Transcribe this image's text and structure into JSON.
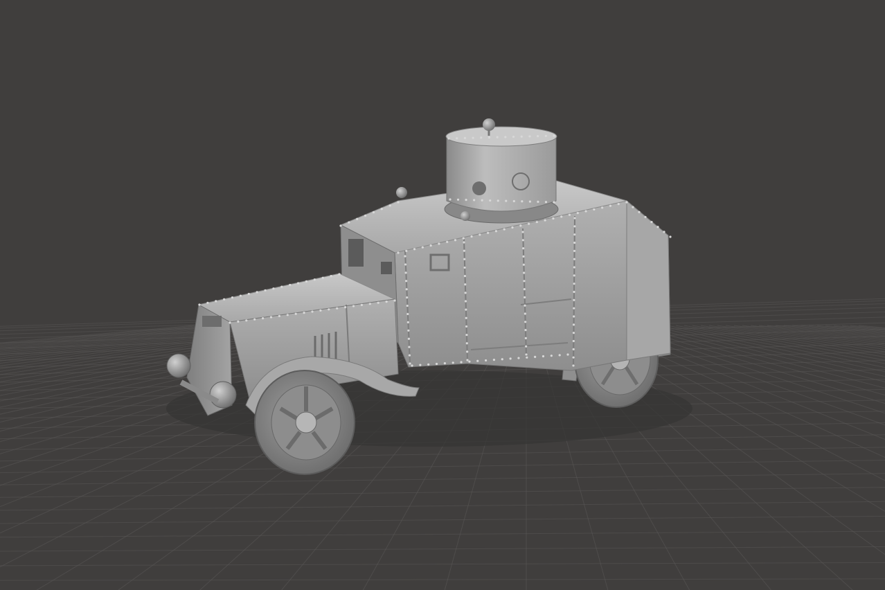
{
  "viewport": {
    "background": "#403e3d",
    "grid_color": "#5a5857",
    "model": {
      "name": "armored-car",
      "base_color": "#9c9c9c",
      "light_color": "#bdbdbd",
      "dark_color": "#6a6a6a",
      "shadow_color": "#4a4a4a"
    },
    "rivet_color": "#d8d8d8"
  }
}
